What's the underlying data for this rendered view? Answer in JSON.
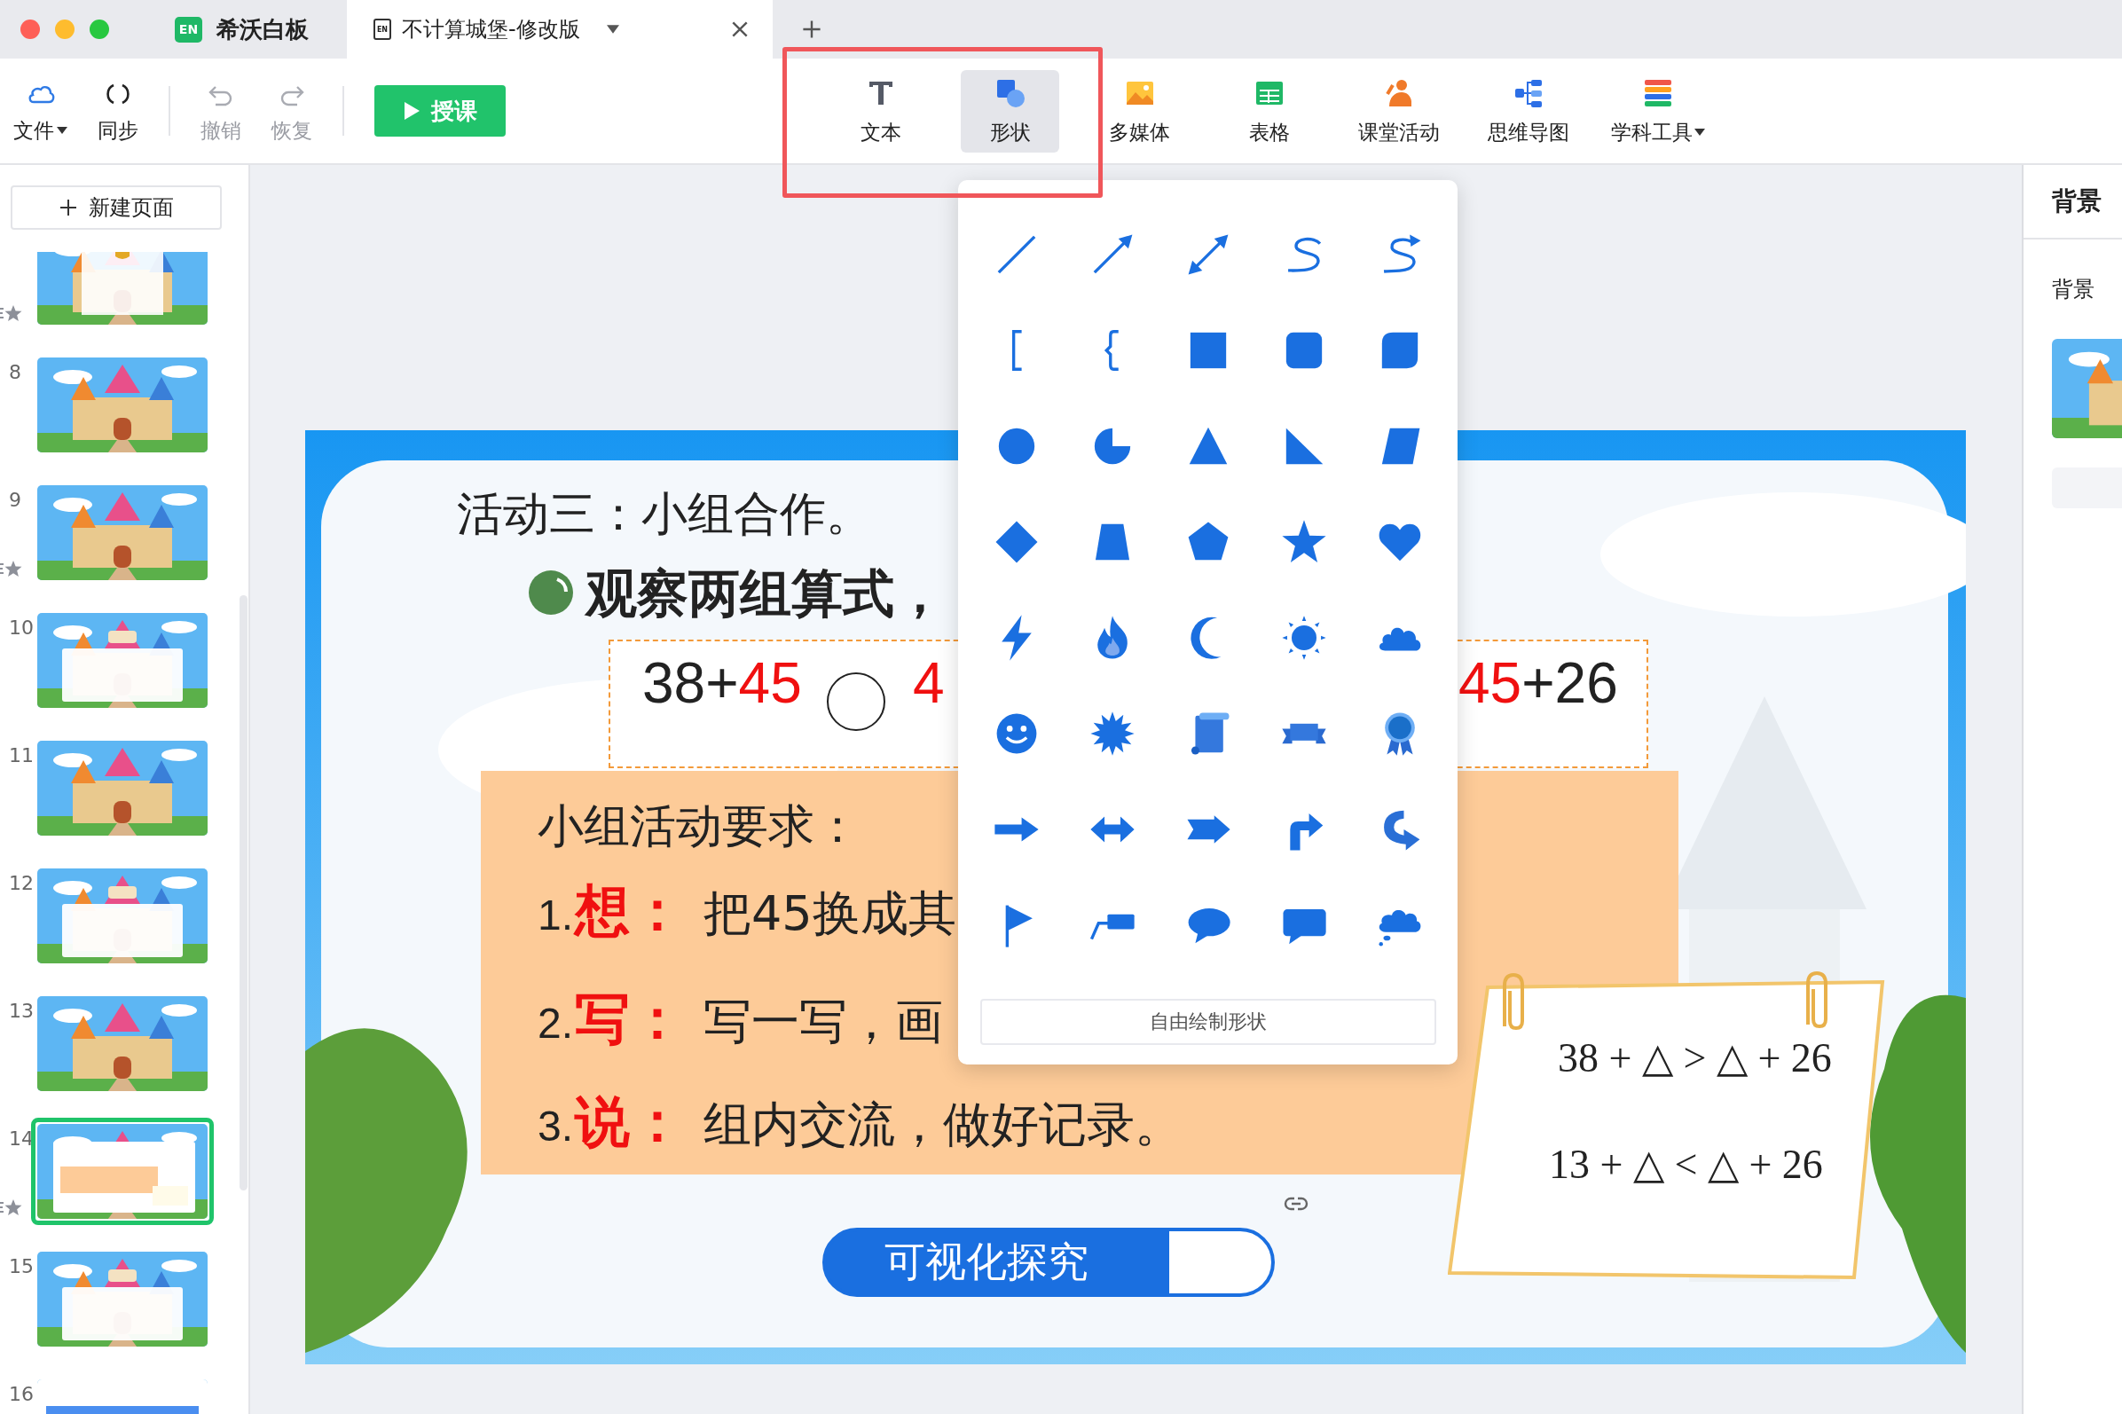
{
  "window": {
    "app_badge": "EN",
    "tabs": [
      {
        "kind": "app",
        "label": "希沃白板",
        "selected": false
      },
      {
        "kind": "document",
        "badge": "EN",
        "label": "不计算城堡-修改版",
        "selected": true
      }
    ]
  },
  "toolbar": {
    "items": [
      {
        "label": "文件",
        "dropdown": true,
        "disabled": false
      },
      {
        "label": "同步",
        "dropdown": false,
        "disabled": false
      },
      {
        "label": "撤销",
        "dropdown": false,
        "disabled": true
      },
      {
        "label": "恢复",
        "dropdown": false,
        "disabled": true
      }
    ],
    "teach_button": "授课",
    "tools": [
      {
        "label": "文本",
        "selected": false,
        "dropdown": false
      },
      {
        "label": "形状",
        "selected": true,
        "dropdown": false
      },
      {
        "label": "多媒体",
        "selected": false,
        "dropdown": false
      },
      {
        "label": "表格",
        "selected": false,
        "dropdown": false
      },
      {
        "label": "课堂活动",
        "selected": false,
        "dropdown": false
      },
      {
        "label": "思维导图",
        "selected": false,
        "dropdown": false
      },
      {
        "label": "学科工具",
        "selected": false,
        "dropdown": true
      }
    ]
  },
  "sidebar": {
    "new_page_button": "新建页面",
    "slides": [
      {
        "starred": true,
        "selected": false
      },
      {
        "number": "8",
        "starred": false,
        "selected": false
      },
      {
        "number": "9",
        "starred": true,
        "selected": false
      },
      {
        "number": "10",
        "starred": false,
        "selected": false
      },
      {
        "number": "11",
        "starred": false,
        "selected": false
      },
      {
        "number": "12",
        "starred": false,
        "selected": false
      },
      {
        "number": "13",
        "starred": false,
        "selected": false
      },
      {
        "number": "14",
        "starred": true,
        "selected": true
      },
      {
        "number": "15",
        "starred": false,
        "selected": false
      },
      {
        "number": "16",
        "starred": false,
        "selected": false
      }
    ]
  },
  "slide": {
    "title": "活动三：小组合作。",
    "prompt": "观察两组算式，",
    "left_expression": [
      {
        "text": "38+",
        "highlight": false
      },
      {
        "text": "45",
        "highlight": true
      }
    ],
    "second_expression": [
      {
        "text": "4",
        "highlight": true
      }
    ],
    "right_expression": [
      {
        "text": "45",
        "highlight": true
      },
      {
        "text": "+26",
        "highlight": false
      }
    ],
    "requirements": {
      "heading": "小组活动要求：",
      "items": [
        {
          "number": "1.",
          "keyword": "想：",
          "text": "把45换成其"
        },
        {
          "number": "2.",
          "keyword": "写：",
          "text": "写一写，画"
        },
        {
          "number": "3.",
          "keyword": "说：",
          "text": "组内交流，做好记录。"
        }
      ]
    },
    "explore_button": "可视化探究",
    "note": [
      "38 + △ > △ + 26",
      "13 + △ < △ + 26"
    ]
  },
  "shape_panel": {
    "free_draw_button": "自由绘制形状"
  },
  "properties_panel": {
    "title": "背景",
    "section": "背景"
  }
}
